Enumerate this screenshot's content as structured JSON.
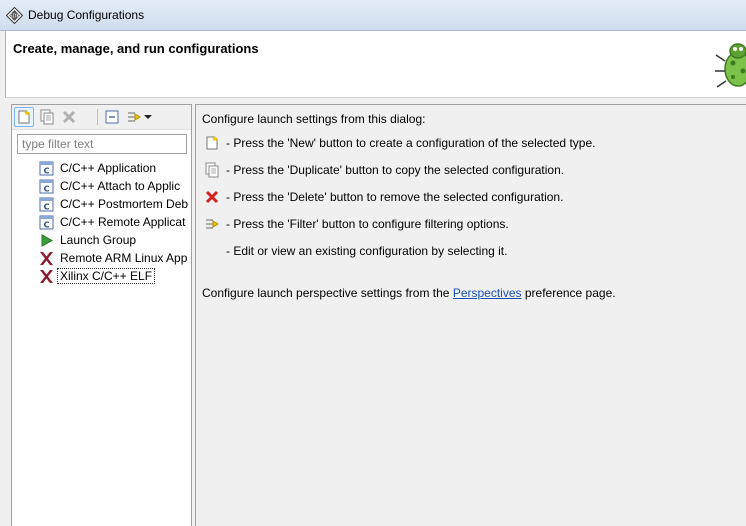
{
  "window": {
    "title": "Debug Configurations"
  },
  "header": {
    "title": "Create, manage, and run configurations"
  },
  "toolbar": {
    "buttons": [
      "new-icon",
      "duplicate-icon",
      "delete-icon",
      "collapse-all-icon",
      "filter-icon",
      "chevron-down-icon"
    ]
  },
  "filter": {
    "placeholder": "type filter text",
    "value": ""
  },
  "tree": {
    "items": [
      {
        "label": "C/C++ Application",
        "icon": "c-app-icon"
      },
      {
        "label": "C/C++ Attach to Applic",
        "icon": "c-app-icon"
      },
      {
        "label": "C/C++ Postmortem Deb",
        "icon": "c-app-icon"
      },
      {
        "label": "C/C++ Remote Applicat",
        "icon": "c-app-icon"
      },
      {
        "label": "Launch Group",
        "icon": "launch-group-icon"
      },
      {
        "label": "Remote ARM Linux App",
        "icon": "xilinx-icon"
      },
      {
        "label": "Xilinx C/C++ ELF",
        "icon": "xilinx-icon",
        "selected": true
      }
    ]
  },
  "help": {
    "intro": "Configure launch settings from this dialog:",
    "lines": [
      {
        "icon": "new-icon",
        "text": "- Press the 'New' button to create a configuration of the selected type."
      },
      {
        "icon": "duplicate-icon",
        "text": "- Press the 'Duplicate' button to copy the selected configuration."
      },
      {
        "icon": "delete-icon",
        "text": "- Press the 'Delete' button to remove the selected configuration."
      },
      {
        "icon": "filter-icon",
        "text": "- Press the 'Filter' button to configure filtering options."
      },
      {
        "icon": "",
        "text": "- Edit or view an existing configuration by selecting it."
      }
    ],
    "perspectives_prefix": "Configure launch perspective settings from the ",
    "perspectives_link": "Perspectives",
    "perspectives_suffix": " preference page."
  },
  "colors": {
    "link": "#1a4fb4",
    "delete": "#d42020",
    "titlebar": "#dae6f4"
  }
}
